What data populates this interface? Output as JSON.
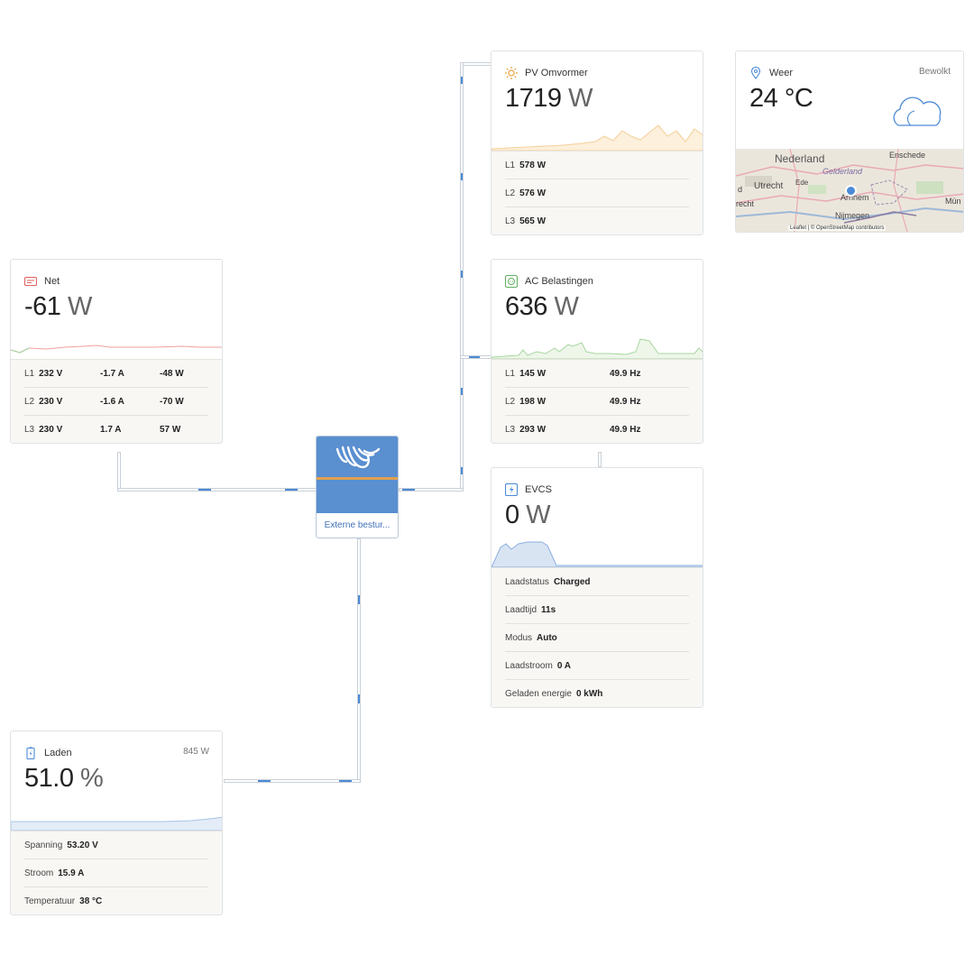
{
  "pv": {
    "title": "PV Omvormer",
    "value": "1719",
    "unit": "W",
    "rows": [
      {
        "phase": "L1",
        "power": "578 W"
      },
      {
        "phase": "L2",
        "power": "576 W"
      },
      {
        "phase": "L3",
        "power": "565 W"
      }
    ]
  },
  "weather": {
    "title": "Weer",
    "condition": "Bewolkt",
    "temp": "24 °C",
    "map": {
      "country": "Nederland",
      "region": "Gelderland",
      "cities": [
        "Enschede",
        "Utrecht",
        "Ede",
        "Arnhem",
        "Nijmegen",
        "Mün",
        "recht",
        "d"
      ],
      "attribution": "Leaflet | © OpenStreetMap contributors"
    }
  },
  "grid": {
    "title": "Net",
    "value": "-61",
    "unit": "W",
    "rows": [
      {
        "phase": "L1",
        "voltage": "232 V",
        "current": "-1.7 A",
        "power": "-48 W"
      },
      {
        "phase": "L2",
        "voltage": "230 V",
        "current": "-1.6 A",
        "power": "-70 W"
      },
      {
        "phase": "L3",
        "voltage": "230 V",
        "current": "1.7 A",
        "power": "57 W"
      }
    ]
  },
  "ac": {
    "title": "AC Belastingen",
    "value": "636",
    "unit": "W",
    "rows": [
      {
        "phase": "L1",
        "power": "145 W",
        "freq": "49.9 Hz"
      },
      {
        "phase": "L2",
        "power": "198 W",
        "freq": "49.9 Hz"
      },
      {
        "phase": "L3",
        "power": "293 W",
        "freq": "49.9 Hz"
      }
    ]
  },
  "inverter": {
    "label": "Externe bestur..."
  },
  "evcs": {
    "title": "EVCS",
    "value": "0",
    "unit": "W",
    "rows": [
      {
        "label": "Laadstatus",
        "value": "Charged"
      },
      {
        "label": "Laadtijd",
        "value": "11s"
      },
      {
        "label": "Modus",
        "value": "Auto"
      },
      {
        "label": "Laadstroom",
        "value": "0 A"
      },
      {
        "label": "Geladen energie",
        "value": "0 kWh"
      }
    ]
  },
  "battery": {
    "title": "Laden",
    "power": "845 W",
    "value": "51.0",
    "unit": "%",
    "rows": [
      {
        "label": "Spanning",
        "value": "53.20 V"
      },
      {
        "label": "Stroom",
        "value": "15.9 A"
      },
      {
        "label": "Temperatuur",
        "value": "38 °C"
      }
    ]
  },
  "colors": {
    "accent": "#4b8ad6",
    "pv": "#e8a23a",
    "ac": "#5fb05f",
    "grid": "#e06060",
    "evcs": "#8aaee0",
    "battery": "#6f9fd8"
  },
  "icons": {
    "pv": "sun-icon",
    "weather": "location-pin-icon",
    "cloud": "cloud-icon",
    "grid": "grid-meter-icon",
    "ac": "outlet-icon",
    "evcs": "ev-charger-icon",
    "battery": "battery-icon",
    "inverter": "victron-logo-icon"
  }
}
